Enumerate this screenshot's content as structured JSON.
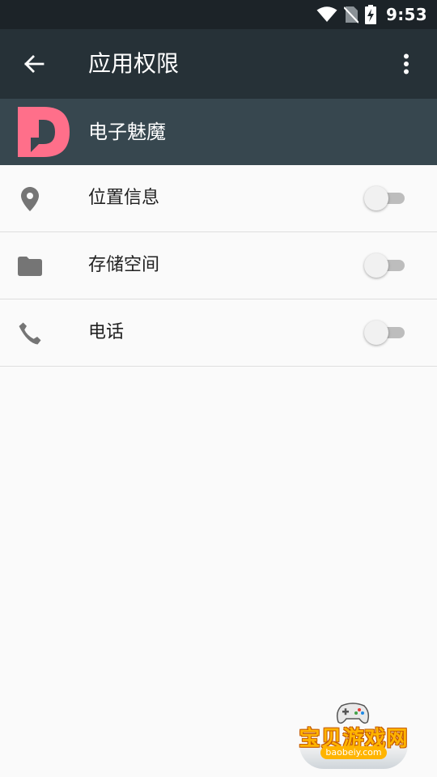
{
  "status_bar": {
    "time": "9:53",
    "icons": [
      "wifi-icon",
      "no-sim-icon",
      "battery-charging-icon"
    ]
  },
  "toolbar": {
    "title": "应用权限",
    "back_icon": "arrow-back-icon",
    "overflow_icon": "more-vert-icon"
  },
  "app": {
    "name": "电子魅魔",
    "logo_icon": "app-logo-icon",
    "logo_color": "#ff6f8a"
  },
  "permissions": [
    {
      "label": "位置信息",
      "icon": "location-pin-icon",
      "enabled": false
    },
    {
      "label": "存储空间",
      "icon": "folder-icon",
      "enabled": false
    },
    {
      "label": "电话",
      "icon": "phone-icon",
      "enabled": false
    }
  ],
  "watermark": {
    "title": "宝贝游戏网",
    "domain": "baobeiy.com"
  },
  "colors": {
    "status_bar": "#1c2328",
    "toolbar": "#263137",
    "app_header": "#37474f",
    "background": "#fafafa",
    "icon_gray": "#757575"
  }
}
